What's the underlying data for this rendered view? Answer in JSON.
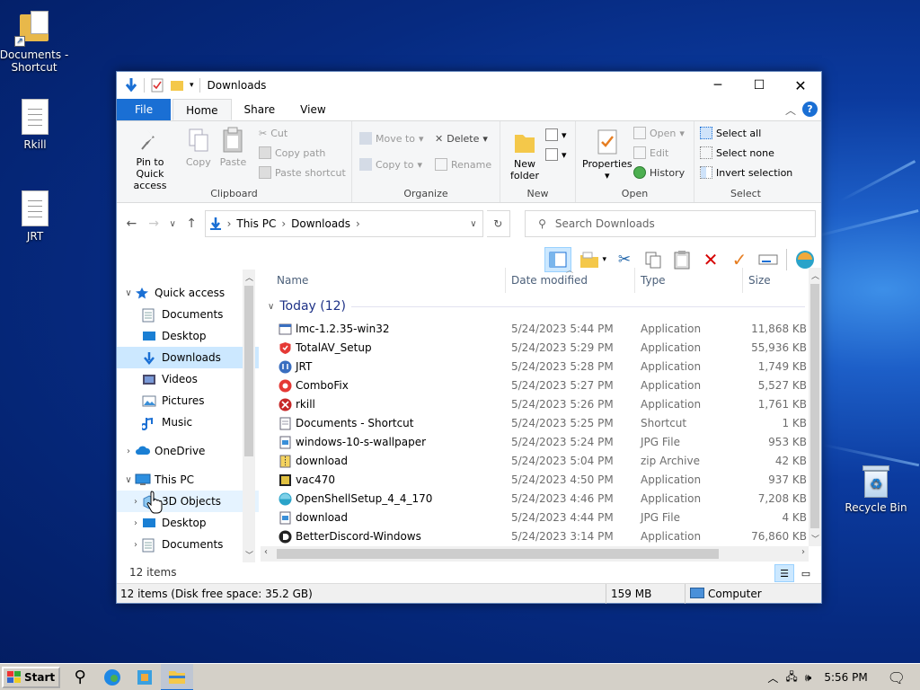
{
  "desktop": {
    "icons": [
      {
        "label": "Documents - Shortcut"
      },
      {
        "label": "Rkill"
      },
      {
        "label": "JRT"
      },
      {
        "label": "Recycle Bin"
      }
    ]
  },
  "window": {
    "title": "Downloads",
    "controls": {
      "minimize": "─",
      "maximize": "☐",
      "close": "✕"
    },
    "tabs": {
      "file": "File",
      "home": "Home",
      "share": "Share",
      "view": "View"
    },
    "help": "?",
    "ribbon": {
      "clipboard": {
        "label": "Clipboard",
        "pin": "Pin to Quick access",
        "copy": "Copy",
        "paste": "Paste",
        "cut": "Cut",
        "copy_path": "Copy path",
        "paste_shortcut": "Paste shortcut"
      },
      "organize": {
        "label": "Organize",
        "move_to": "Move to",
        "copy_to": "Copy to",
        "delete": "Delete",
        "rename": "Rename"
      },
      "new": {
        "label": "New",
        "new_folder": "New folder"
      },
      "open": {
        "label": "Open",
        "properties": "Properties",
        "open": "Open",
        "edit": "Edit",
        "history": "History"
      },
      "select": {
        "label": "Select",
        "select_all": "Select all",
        "select_none": "Select none",
        "invert": "Invert selection"
      }
    },
    "address": {
      "crumbs": [
        "This PC",
        "Downloads"
      ],
      "search_placeholder": "Search Downloads"
    },
    "nav": [
      {
        "label": "Quick access",
        "level": 0,
        "chev": "∨",
        "icon": "star"
      },
      {
        "label": "Documents",
        "level": 1,
        "pin": true,
        "icon": "doc"
      },
      {
        "label": "Desktop",
        "level": 1,
        "pin": true,
        "icon": "desktop"
      },
      {
        "label": "Downloads",
        "level": 1,
        "pin": true,
        "icon": "down",
        "selected": true
      },
      {
        "label": "Videos",
        "level": 1,
        "pin": true,
        "icon": "video"
      },
      {
        "label": "Pictures",
        "level": 1,
        "pin": true,
        "icon": "pic"
      },
      {
        "label": "Music",
        "level": 1,
        "icon": "music"
      },
      {
        "label": "OneDrive",
        "level": 0,
        "chev": "›",
        "icon": "cloud",
        "gap": true
      },
      {
        "label": "This PC",
        "level": 0,
        "chev": "∨",
        "icon": "pc",
        "gap": true
      },
      {
        "label": "3D Objects",
        "level": 1,
        "chev": "›",
        "icon": "cube",
        "hover": true
      },
      {
        "label": "Desktop",
        "level": 1,
        "chev": "›",
        "icon": "desktop"
      },
      {
        "label": "Documents",
        "level": 1,
        "chev": "›",
        "icon": "doc"
      }
    ],
    "columns": {
      "name": "Name",
      "date": "Date modified",
      "type": "Type",
      "size": "Size"
    },
    "group": "Today (12)",
    "files": [
      {
        "name": "lmc-1.2.35-win32",
        "date": "5/24/2023 5:44 PM",
        "type": "Application",
        "size": "11,868 KB",
        "icon": "app"
      },
      {
        "name": "TotalAV_Setup",
        "date": "5/24/2023 5:29 PM",
        "type": "Application",
        "size": "55,936 KB",
        "icon": "shield"
      },
      {
        "name": "JRT",
        "date": "5/24/2023 5:28 PM",
        "type": "Application",
        "size": "1,749 KB",
        "icon": "jrt"
      },
      {
        "name": "ComboFix",
        "date": "5/24/2023 5:27 PM",
        "type": "Application",
        "size": "5,527 KB",
        "icon": "combo"
      },
      {
        "name": "rkill",
        "date": "5/24/2023 5:26 PM",
        "type": "Application",
        "size": "1,761 KB",
        "icon": "rkill"
      },
      {
        "name": "Documents - Shortcut",
        "date": "5/24/2023 5:25 PM",
        "type": "Shortcut",
        "size": "1 KB",
        "icon": "shortcut"
      },
      {
        "name": "windows-10-s-wallpaper",
        "date": "5/24/2023 5:24 PM",
        "type": "JPG File",
        "size": "953 KB",
        "icon": "jpg"
      },
      {
        "name": "download",
        "date": "5/24/2023 5:04 PM",
        "type": "zip Archive",
        "size": "42 KB",
        "icon": "zip"
      },
      {
        "name": "vac470",
        "date": "5/24/2023 4:50 PM",
        "type": "Application",
        "size": "937 KB",
        "icon": "vac"
      },
      {
        "name": "OpenShellSetup_4_4_170",
        "date": "5/24/2023 4:46 PM",
        "type": "Application",
        "size": "7,208 KB",
        "icon": "shell"
      },
      {
        "name": "download",
        "date": "5/24/2023 4:44 PM",
        "type": "JPG File",
        "size": "4 KB",
        "icon": "jpg"
      },
      {
        "name": "BetterDiscord-Windows",
        "date": "5/24/2023 3:14 PM",
        "type": "Application",
        "size": "76,860 KB",
        "icon": "bd"
      }
    ],
    "item_count": "12 items",
    "status": {
      "left": "12 items (Disk free space: 35.2 GB)",
      "size": "159 MB",
      "location": "Computer"
    }
  },
  "taskbar": {
    "start": "Start",
    "time": "5:56 PM"
  }
}
